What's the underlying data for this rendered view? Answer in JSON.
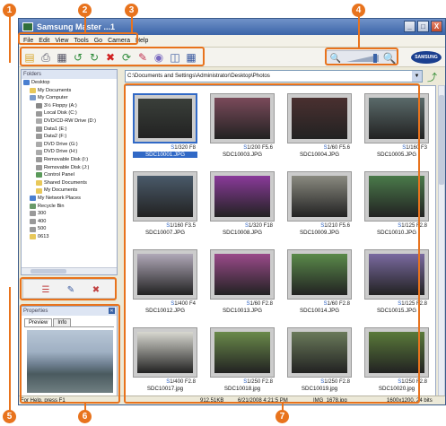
{
  "callouts": [
    "1",
    "2",
    "3",
    "4",
    "5",
    "6",
    "7"
  ],
  "window": {
    "title": "Samsung Master ...1",
    "buttons": [
      "_",
      "□",
      "X"
    ]
  },
  "menu": [
    "File",
    "Edit",
    "View",
    "Tools",
    "Go",
    "Camera",
    "Help"
  ],
  "toolbar": {
    "brand": "SAMSUNG"
  },
  "folders": {
    "header": "Folders",
    "items": [
      {
        "label": "Desktop",
        "indent": 0,
        "color": "#4a7fd0"
      },
      {
        "label": "My Documents",
        "indent": 1,
        "color": "#e8c85a"
      },
      {
        "label": "My Computer",
        "indent": 1,
        "color": "#7a9acb"
      },
      {
        "label": "3½ Floppy (A:)",
        "indent": 2,
        "color": "#888"
      },
      {
        "label": "Local Disk (C:)",
        "indent": 2,
        "color": "#999"
      },
      {
        "label": "DVD/CD-RW Drive (D:)",
        "indent": 2,
        "color": "#aaa"
      },
      {
        "label": "Data1 (E:)",
        "indent": 2,
        "color": "#999"
      },
      {
        "label": "Data2 (F:)",
        "indent": 2,
        "color": "#999"
      },
      {
        "label": "DVD Drive (G:)",
        "indent": 2,
        "color": "#aaa"
      },
      {
        "label": "DVD Drive (H:)",
        "indent": 2,
        "color": "#aaa"
      },
      {
        "label": "Removable Disk (I:)",
        "indent": 2,
        "color": "#999"
      },
      {
        "label": "Removable Disk (J:)",
        "indent": 2,
        "color": "#999"
      },
      {
        "label": "Control Panel",
        "indent": 2,
        "color": "#5a9a5a"
      },
      {
        "label": "Shared Documents",
        "indent": 2,
        "color": "#e8c85a"
      },
      {
        "label": "My Documents",
        "indent": 2,
        "color": "#e8c85a"
      },
      {
        "label": "My Network Places",
        "indent": 1,
        "color": "#4a7fd0"
      },
      {
        "label": "Recycle Bin",
        "indent": 1,
        "color": "#6a9a6a"
      },
      {
        "label": "300",
        "indent": 1,
        "color": "#999"
      },
      {
        "label": "400",
        "indent": 1,
        "color": "#999"
      },
      {
        "label": "500",
        "indent": 1,
        "color": "#999"
      },
      {
        "label": "0613",
        "indent": 1,
        "color": "#e8c85a"
      }
    ]
  },
  "properties": {
    "header": "Properties",
    "tabs": [
      "Preview",
      "Info"
    ]
  },
  "path": "C:\\Documents and Settings\\Administrator\\Desktop\\Photos",
  "photos": [
    {
      "shutter": "1/320",
      "aperture": "F8",
      "name": "SDC10001.JPG",
      "selected": true,
      "color": "#3a3f3a"
    },
    {
      "shutter": "1/200",
      "aperture": "F5.6",
      "name": "SDC10003.JPG",
      "selected": false,
      "color": "#7a4a5a"
    },
    {
      "shutter": "1/60",
      "aperture": "F5.6",
      "name": "SDC10004.JPG",
      "selected": false,
      "color": "#4a3030"
    },
    {
      "shutter": "1/160",
      "aperture": "F3",
      "name": "SDC10005.JPG",
      "selected": false,
      "color": "#5a6a6a"
    },
    {
      "shutter": "1/160",
      "aperture": "F3.5",
      "name": "SDC10007.JPG",
      "selected": false,
      "color": "#4a5a6a"
    },
    {
      "shutter": "1/320",
      "aperture": "F18",
      "name": "SDC10008.JPG",
      "selected": false,
      "color": "#8a3a9a"
    },
    {
      "shutter": "1/210",
      "aperture": "F5.6",
      "name": "SDC10009.JPG",
      "selected": false,
      "color": "#8a8a80"
    },
    {
      "shutter": "1/125",
      "aperture": "F2.8",
      "name": "SDC10010.JPG",
      "selected": false,
      "color": "#4a7a4a"
    },
    {
      "shutter": "1/400",
      "aperture": "F4",
      "name": "SDC10012.JPG",
      "selected": false,
      "color": "#b0a8b8"
    },
    {
      "shutter": "1/60",
      "aperture": "F2.8",
      "name": "SDC10013.JPG",
      "selected": false,
      "color": "#9a4a8a"
    },
    {
      "shutter": "1/60",
      "aperture": "F2.8",
      "name": "SDC10014.JPG",
      "selected": false,
      "color": "#5a8a4a"
    },
    {
      "shutter": "1/125",
      "aperture": "F2.8",
      "name": "SDC10015.JPG",
      "selected": false,
      "color": "#7a6aa0"
    },
    {
      "shutter": "1/400",
      "aperture": "F2.8",
      "name": "SDC10017.jpg",
      "selected": false,
      "color": "#d8d8d0"
    },
    {
      "shutter": "1/250",
      "aperture": "F2.8",
      "name": "SDC10018.jpg",
      "selected": false,
      "color": "#6a8a4a"
    },
    {
      "shutter": "1/250",
      "aperture": "F2.8",
      "name": "SDC10019.jpg",
      "selected": false,
      "color": "#6a7a5a"
    },
    {
      "shutter": "1/250",
      "aperture": "F2.8",
      "name": "SDC10020.jpg",
      "selected": false,
      "color": "#5a7a3a"
    }
  ],
  "status": {
    "help": "For Help, press F1",
    "size": "912.51KB",
    "date": "6/21/2008 4:21:5 PM",
    "file": "IMG_1678.jpg",
    "dims": "1600x1200, 24 bits"
  }
}
